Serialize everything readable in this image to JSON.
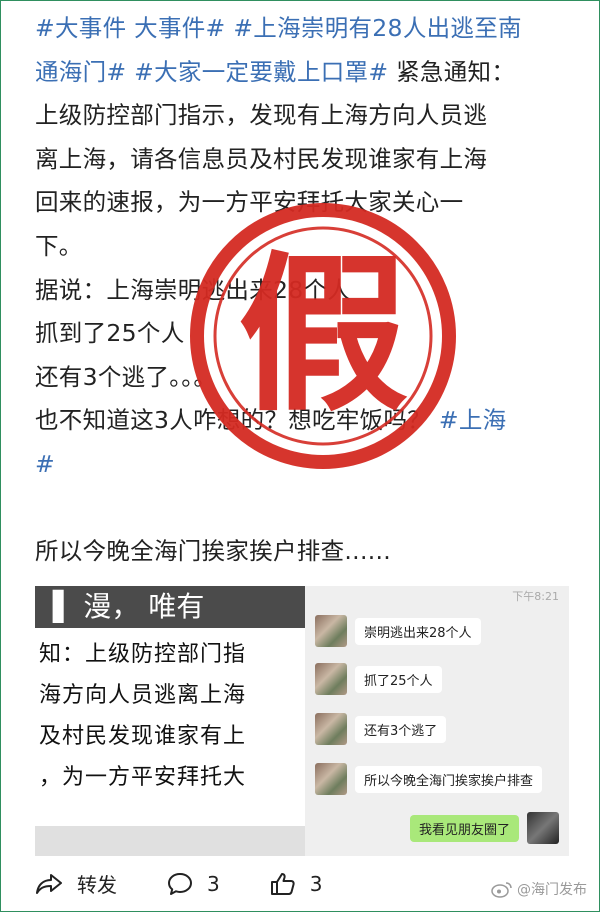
{
  "post": {
    "lines": [
      {
        "tag": "#大事件 大事件# #上海崇明有28人出逃至南",
        "rest": ""
      },
      {
        "tag": "通海门# #大家一定要戴上口罩#",
        "rest": " 紧急通知："
      },
      {
        "tag": "",
        "rest": "上级防控部门指示，发现有上海方向人员逃"
      },
      {
        "tag": "",
        "rest": "离上海，请各信息员及村民发现谁家有上海"
      },
      {
        "tag": "",
        "rest": "回来的速报，为一方平安拜托大家关心一"
      },
      {
        "tag": "",
        "rest": "下。"
      },
      {
        "tag": "",
        "rest": "据说：上海崇明逃出来28个人"
      },
      {
        "tag": "",
        "rest": "抓到了25个人"
      },
      {
        "tag": "",
        "rest": "还有3个逃了。。。"
      },
      {
        "tag": "",
        "rest": "也不知道这3人咋想的？想吃牢饭吗？"
      },
      {
        "tag": "#",
        "rest": ""
      },
      {
        "tag": "",
        "rest": ""
      },
      {
        "tag": "",
        "rest": "所以今晚全海门挨家挨户排查......"
      }
    ],
    "line9_tag": "#上海"
  },
  "screenshot_left": {
    "bar_text": "▌  漫，   唯有",
    "lines": [
      "知：上级防控部门指",
      "海方向人员逃离上海",
      "及村民发现谁家有上",
      "，为一方平安拜托大"
    ]
  },
  "screenshot_right": {
    "top_text": "下午8:21",
    "messages": [
      "崇明逃出来28个人",
      "抓了25个人",
      "还有3个逃了",
      "所以今晚全海门挨家挨户排查"
    ],
    "my_message": "我看见朋友圈了"
  },
  "actions": {
    "forward": "转发",
    "comments": "3",
    "likes": "3"
  },
  "stamp": {
    "char": "假",
    "color": "#d42a22"
  },
  "watermark": "@海门发布",
  "colors": {
    "tag": "#3b6fb4",
    "stamp": "#d42a22"
  }
}
